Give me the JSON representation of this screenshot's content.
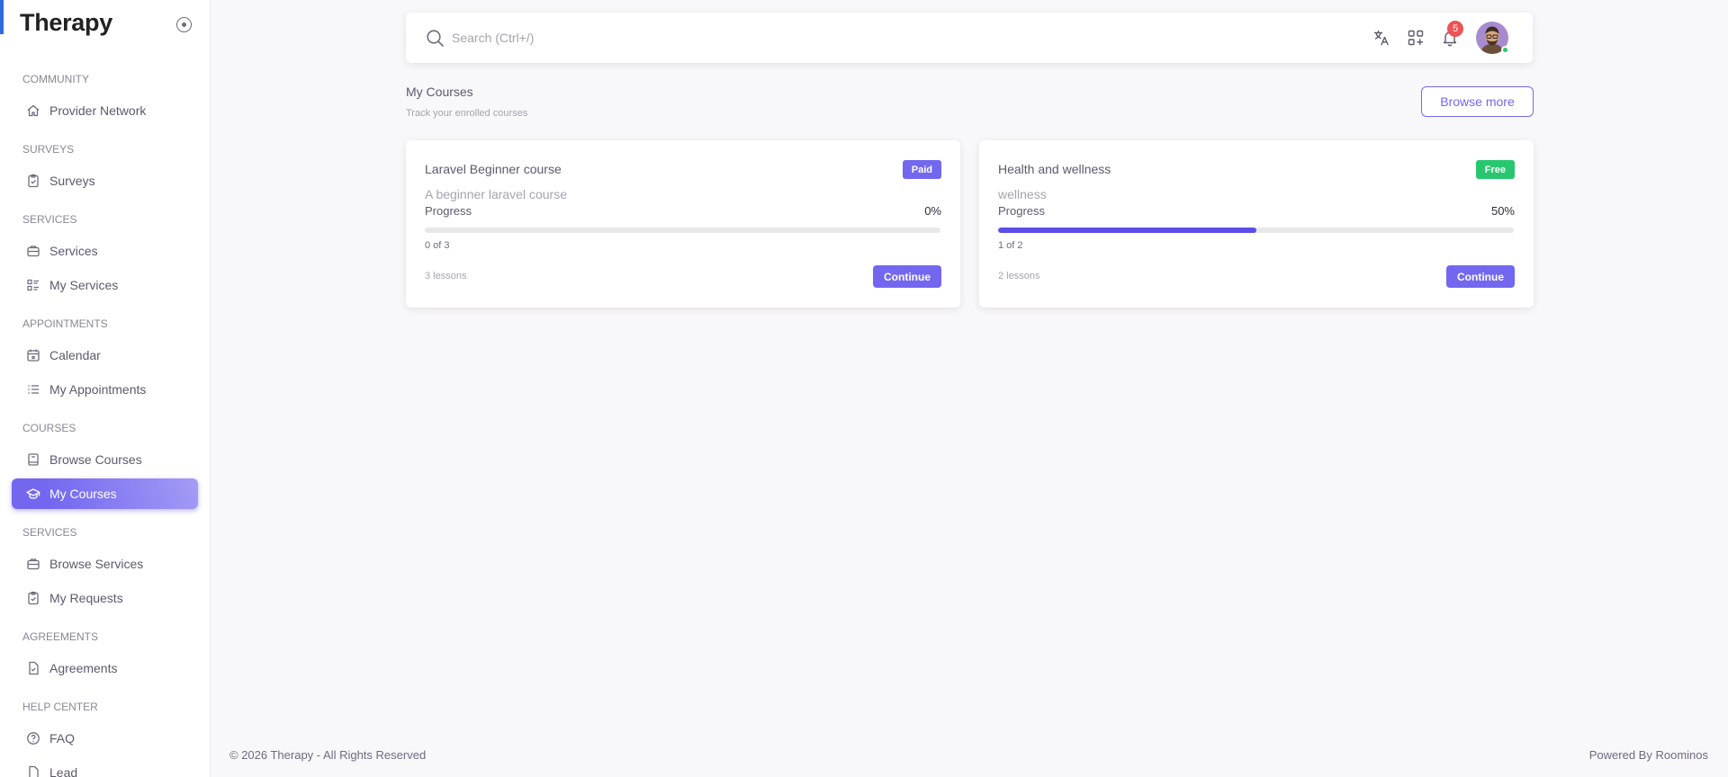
{
  "sidebar": {
    "brand": "Therapy",
    "sections": [
      {
        "title": "COMMUNITY",
        "items": [
          {
            "label": "Provider Network",
            "icon": "home-icon"
          }
        ]
      },
      {
        "title": "SURVEYS",
        "items": [
          {
            "label": "Surveys",
            "icon": "clipboard-check-icon"
          }
        ]
      },
      {
        "title": "SERVICES",
        "items": [
          {
            "label": "Services",
            "icon": "briefcase-icon"
          },
          {
            "label": "My Services",
            "icon": "list-details-icon"
          }
        ]
      },
      {
        "title": "APPOINTMENTS",
        "items": [
          {
            "label": "Calendar",
            "icon": "calendar-icon"
          },
          {
            "label": "My Appointments",
            "icon": "list-icon"
          }
        ]
      },
      {
        "title": "COURSES",
        "items": [
          {
            "label": "Browse Courses",
            "icon": "book-icon"
          },
          {
            "label": "My Courses",
            "icon": "graduation-cap-icon",
            "active": true
          }
        ]
      },
      {
        "title": "SERVICES",
        "items": [
          {
            "label": "Browse Services",
            "icon": "briefcase-icon"
          },
          {
            "label": "My Requests",
            "icon": "clipboard-check-icon"
          }
        ]
      },
      {
        "title": "AGREEMENTS",
        "items": [
          {
            "label": "Agreements",
            "icon": "file-check-icon"
          }
        ]
      },
      {
        "title": "HELP CENTER",
        "items": [
          {
            "label": "FAQ",
            "icon": "help-circle-icon"
          },
          {
            "label": "Lead",
            "icon": "file-icon"
          }
        ]
      }
    ]
  },
  "navbar": {
    "search_placeholder": "Search (Ctrl+/)",
    "notification_count": "5",
    "icons": [
      "translate-icon",
      "apps-add-icon",
      "bell-icon"
    ]
  },
  "page": {
    "title": "My Courses",
    "subtitle": "Track your enrolled courses",
    "browse_more_label": "Browse more"
  },
  "courses": [
    {
      "title": "Laravel Beginner course",
      "badge": "Paid",
      "badge_color": "#7367f0",
      "description": "A beginner laravel course",
      "progress_label": "Progress",
      "progress_text": "0%",
      "progress": 0,
      "count": "0 of 3",
      "lessons": "3 lessons",
      "action": "Continue"
    },
    {
      "title": "Health and wellness",
      "badge": "Free",
      "badge_color": "#28c76f",
      "description": "wellness",
      "progress_label": "Progress",
      "progress_text": "50%",
      "progress": 50,
      "count": "1 of 2",
      "lessons": "2 lessons",
      "action": "Continue"
    }
  ],
  "footer": {
    "copyright": "© 2026 Therapy - All Rights Reserved",
    "powered": "Powered By Roominos"
  },
  "colors": {
    "accent": "#7367f0",
    "success": "#28c76f",
    "danger": "#ea5455"
  }
}
